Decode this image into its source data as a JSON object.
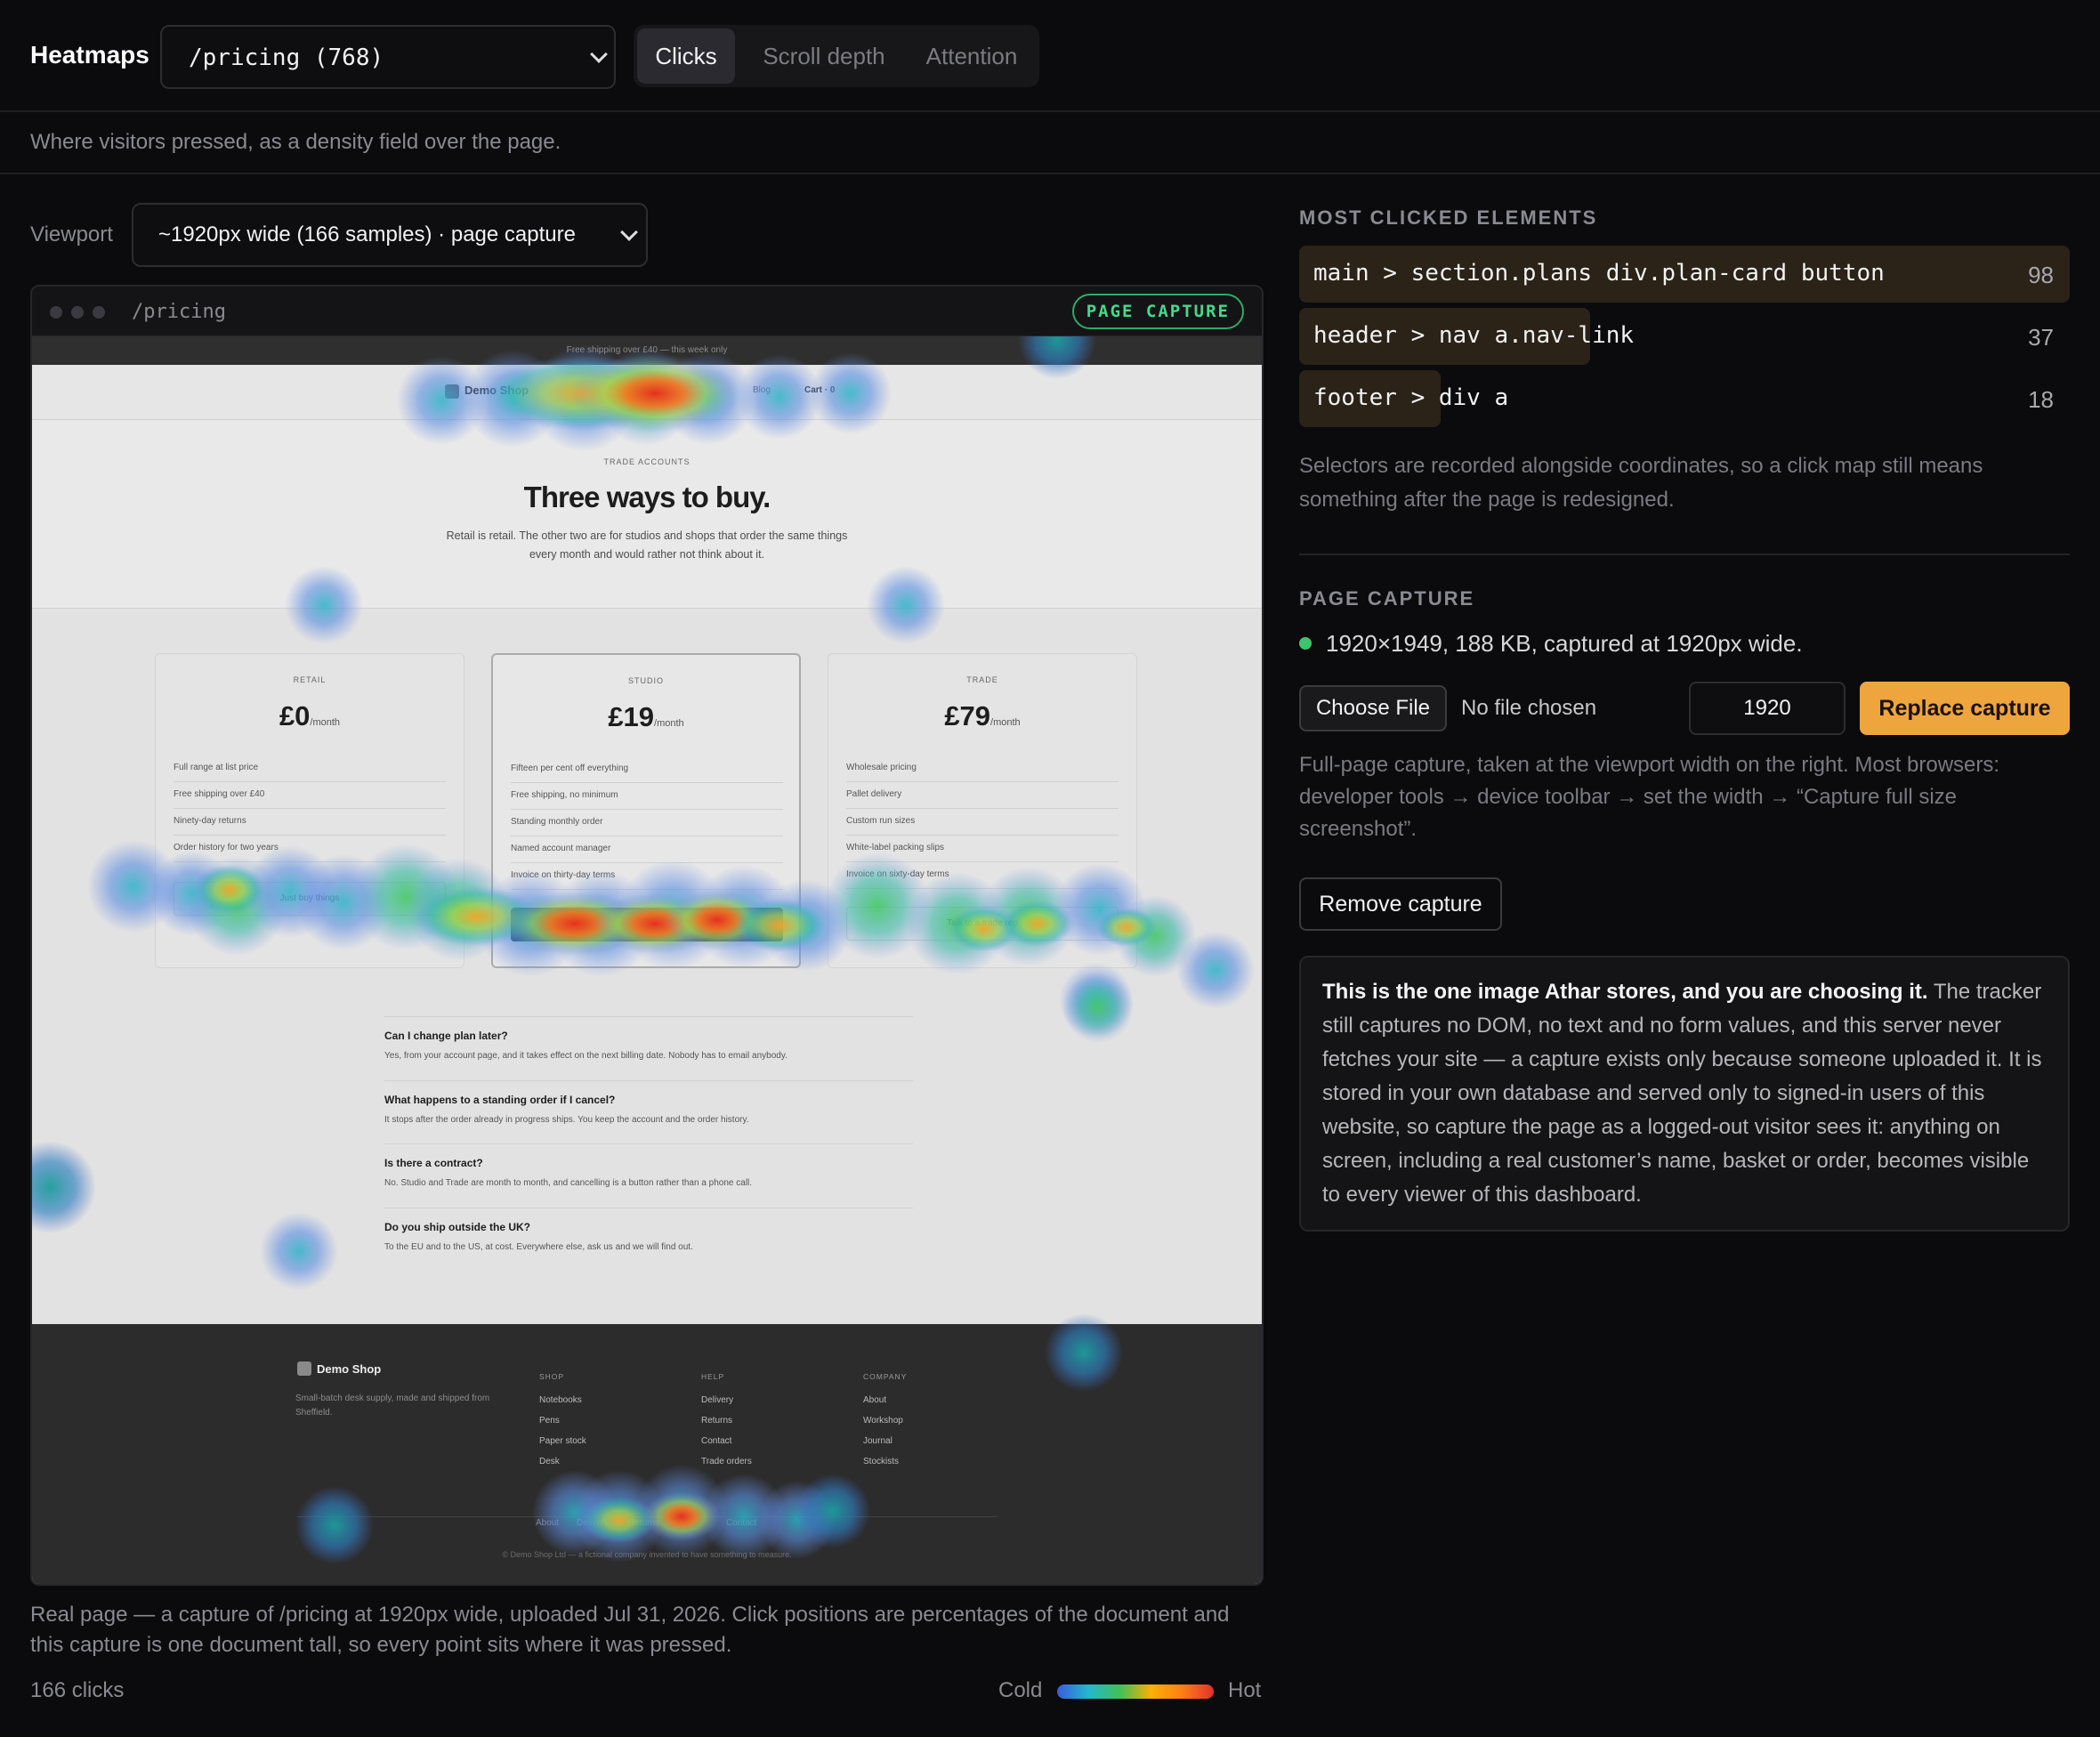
{
  "header": {
    "title": "Heatmaps",
    "page_select": "/pricing (768)",
    "tabs": [
      {
        "label": "Clicks",
        "active": true
      },
      {
        "label": "Scroll depth",
        "active": false
      },
      {
        "label": "Attention",
        "active": false
      }
    ],
    "subtitle": "Where visitors pressed, as a density field over the page."
  },
  "viewport": {
    "label": "Viewport",
    "selected": "~1920px wide (166 samples) · page capture"
  },
  "frame": {
    "path": "/pricing",
    "badge": "PAGE CAPTURE"
  },
  "capture_page": {
    "promo": "Free shipping over £40 — this week only",
    "logo": "Demo Shop",
    "nav": [
      "Blog",
      "Cart · 0"
    ],
    "eyebrow": "TRADE ACCOUNTS",
    "headline": "Three ways to buy.",
    "lead": "Retail is retail. The other two are for studios and shops that order the same things every month and would rather not think about it.",
    "plans": [
      {
        "tier": "RETAIL",
        "price": "£0",
        "per": "/month",
        "features": [
          "Full range at list price",
          "Free shipping over £40",
          "Ninety-day returns",
          "Order history for two years"
        ],
        "cta": "Just buy things"
      },
      {
        "tier": "STUDIO",
        "price": "£19",
        "per": "/month",
        "features": [
          "Fifteen per cent off everything",
          "Free shipping, no minimum",
          "Standing monthly order",
          "Named account manager",
          "Invoice on thirty-day terms"
        ],
        "cta": ""
      },
      {
        "tier": "TRADE",
        "price": "£79",
        "per": "/month",
        "features": [
          "Wholesale pricing",
          "Pallet delivery",
          "Custom run sizes",
          "White-label packing slips",
          "Invoice on sixty-day terms"
        ],
        "cta": "Talk to a trade rep"
      }
    ],
    "faq": [
      {
        "q": "Can I change plan later?",
        "a": "Yes, from your account page, and it takes effect on the next billing date. Nobody has to email anybody."
      },
      {
        "q": "What happens to a standing order if I cancel?",
        "a": "It stops after the order already in progress ships. You keep the account and the order history."
      },
      {
        "q": "Is there a contract?",
        "a": "No. Studio and Trade are month to month, and cancelling is a button rather than a phone call."
      },
      {
        "q": "Do you ship outside the UK?",
        "a": "To the EU and to the US, at cost. Everywhere else, ask us and we will find out."
      }
    ],
    "footer": {
      "logo": "Demo Shop",
      "tagline": "Small-batch desk supply, made and shipped from Sheffield.",
      "cols": [
        {
          "head": "SHOP",
          "links": [
            "Notebooks",
            "Pens",
            "Paper stock",
            "Desk"
          ]
        },
        {
          "head": "HELP",
          "links": [
            "Delivery",
            "Returns",
            "Contact",
            "Trade orders"
          ]
        },
        {
          "head": "COMPANY",
          "links": [
            "About",
            "Workshop",
            "Journal",
            "Stockists"
          ]
        }
      ],
      "bottom_links": [
        "About",
        "Delivery",
        "Returns",
        "Contact"
      ],
      "copyright": "© Demo Shop Ltd — a fictional company invented to have something to measure."
    }
  },
  "caption": "Real page — a capture of /pricing at 1920px wide, uploaded Jul 31, 2026. Click positions are percentages of the document and this capture is one document tall, so every point sits where it was pressed.",
  "clicks_count": "166 clicks",
  "legend": {
    "cold": "Cold",
    "hot": "Hot"
  },
  "most_clicked": {
    "heading": "MOST CLICKED ELEMENTS",
    "items": [
      {
        "selector": "main > section.plans div.plan-card button",
        "count": "98",
        "share": 1.0
      },
      {
        "selector": "header > nav a.nav-link",
        "count": "37",
        "share": 0.378
      },
      {
        "selector": "footer > div a",
        "count": "18",
        "share": 0.184
      }
    ],
    "note": "Selectors are recorded alongside coordinates, so a click map still means something after the page is redesigned."
  },
  "capture": {
    "heading": "PAGE CAPTURE",
    "status": "1920×1949, 188 KB, captured at 1920px wide.",
    "status_color": "#3ec46d",
    "choose_file": "Choose File",
    "no_file": "No file chosen",
    "width_value": "1920",
    "replace_button": "Replace capture",
    "help": "Full-page capture, taken at the viewport width on the right. Most browsers: developer tools → device toolbar → set the width → “Capture full size screenshot”.",
    "remove_button": "Remove capture",
    "warning_strong": "This is the one image Athar stores, and you are choosing it.",
    "warning_body": " The tracker still captures no DOM, no text and no form values, and this server never fetches your site — a capture exists only because someone uploaded it. It is stored in your own database and served only to signed-in users of this website, so capture the page as a logged-out visitor sees it: anything on screen, including a real customer’s name, basket or order, becomes visible to every viewer of this dashboard."
  },
  "colors": {
    "accent": "#eea53d",
    "selector_bar": "#2b2218",
    "badge_green": "#46d98a"
  }
}
